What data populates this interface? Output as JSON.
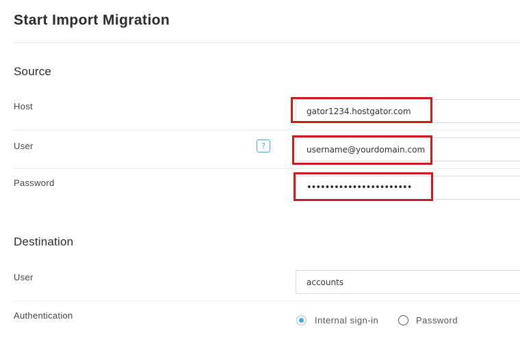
{
  "page": {
    "title": "Start Import Migration"
  },
  "source": {
    "title": "Source",
    "host_label": "Host",
    "host_value": "gator1234.hostgator.com",
    "user_label": "User",
    "user_value": "username@yourdomain.com",
    "help_icon": "?",
    "password_label": "Password",
    "password_value": "•••••••••••••••••••••••"
  },
  "destination": {
    "title": "Destination",
    "user_label": "User",
    "user_value": "accounts",
    "auth_label": "Authentication",
    "auth_options": [
      "Internal sign-in",
      "Password"
    ],
    "auth_selected": "Internal sign-in"
  },
  "colors": {
    "highlight": "#d01919",
    "accent": "#4aa9d8"
  }
}
